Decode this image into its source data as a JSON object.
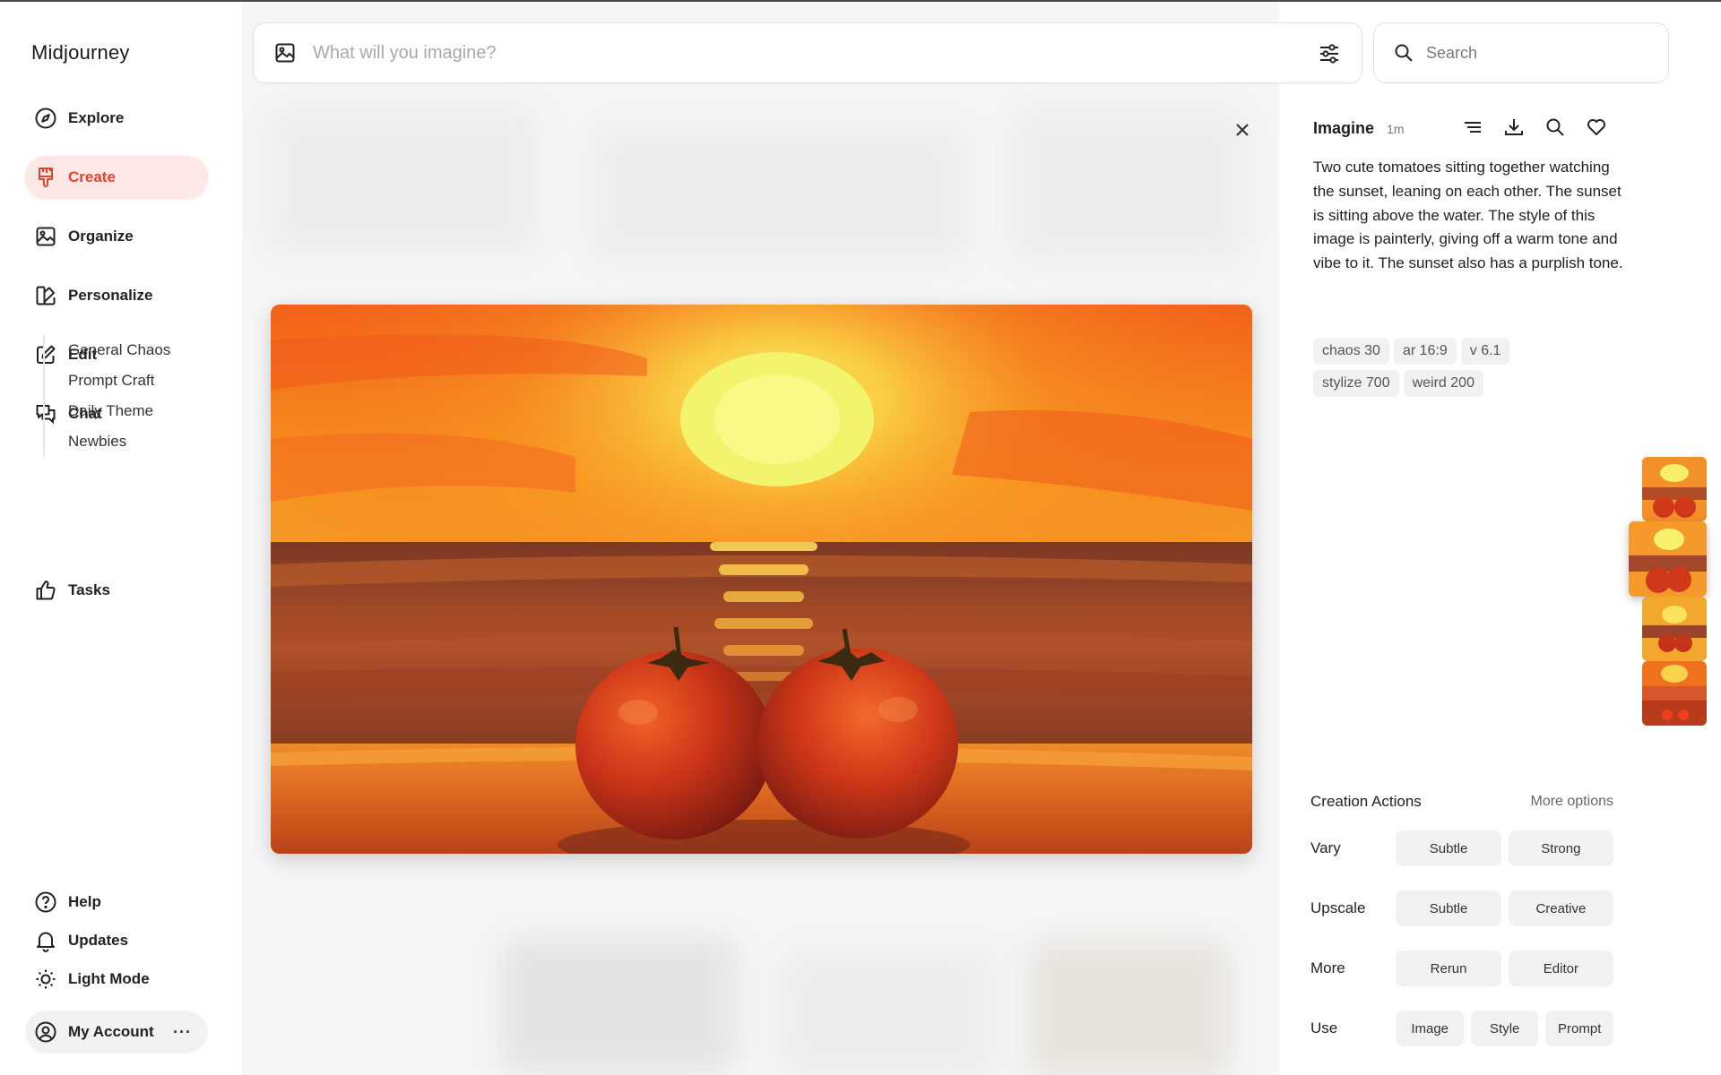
{
  "brand": "Midjourney",
  "nav": [
    {
      "label": "Explore",
      "icon": "compass-icon"
    },
    {
      "label": "Create",
      "icon": "paintbrush-icon",
      "active": true
    },
    {
      "label": "Organize",
      "icon": "image-icon"
    },
    {
      "label": "Personalize",
      "icon": "palette-icon"
    },
    {
      "label": "Edit",
      "icon": "pencil-square-icon"
    },
    {
      "label": "Chat",
      "icon": "chat-bubbles-icon"
    }
  ],
  "chat_channels": [
    "General Chaos",
    "Prompt Craft",
    "Daily Theme",
    "Newbies"
  ],
  "tasks": {
    "label": "Tasks",
    "icon": "thumbs-up-icon"
  },
  "bottom_nav": [
    {
      "label": "Help",
      "icon": "question-circle-icon"
    },
    {
      "label": "Updates",
      "icon": "bell-icon"
    },
    {
      "label": "Light Mode",
      "icon": "sun-icon"
    }
  ],
  "account": {
    "label": "My Account",
    "more": "···"
  },
  "prompt_bar": {
    "placeholder": "What will you imagine?"
  },
  "search": {
    "placeholder": "Search"
  },
  "detail": {
    "title": "Imagine",
    "age": "1m",
    "prompt": "Two cute tomatoes sitting together watching the sunset, leaning on each other. The sunset is sitting above the water. The style of this image is painterly, giving off a warm tone and vibe to it. The sunset also has a purplish tone.",
    "tags": [
      "chaos 30",
      "ar 16:9",
      "v 6.1",
      "stylize 700",
      "weird 200"
    ]
  },
  "creation_actions": {
    "title": "Creation Actions",
    "more": "More options",
    "vary": {
      "label": "Vary",
      "buttons": [
        "Subtle",
        "Strong"
      ]
    },
    "upscale": {
      "label": "Upscale",
      "buttons": [
        "Subtle",
        "Creative"
      ]
    },
    "more_row": {
      "label": "More",
      "buttons": [
        "Rerun",
        "Editor"
      ]
    },
    "use": {
      "label": "Use",
      "buttons": [
        "Image",
        "Style",
        "Prompt"
      ]
    }
  },
  "colors": {
    "accent": "#e0442e",
    "accent_bg": "#fde8e6"
  }
}
